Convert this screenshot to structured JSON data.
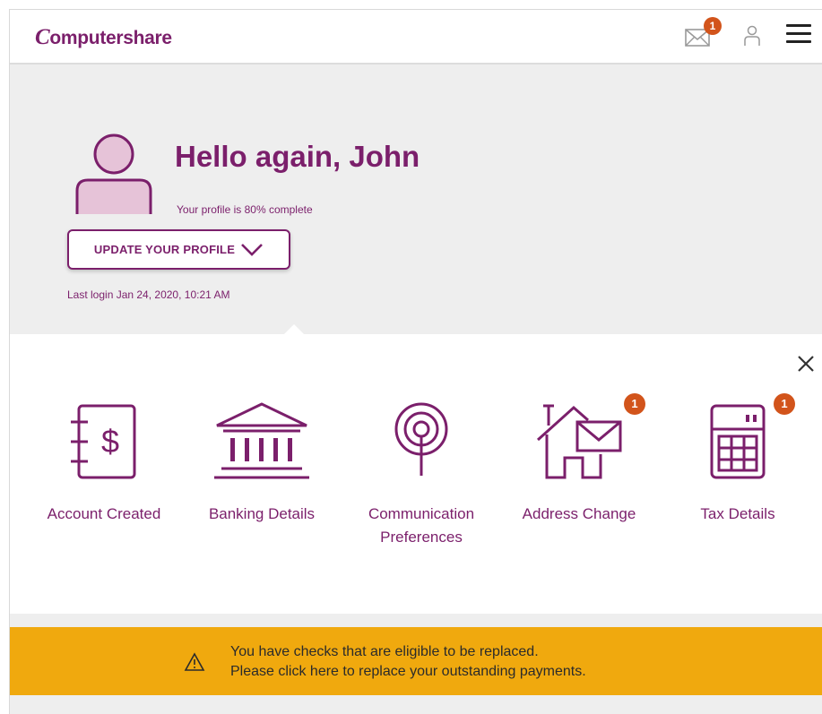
{
  "header": {
    "logo_initial": "C",
    "logo_rest": "omputershare",
    "mail_badge_count": "1"
  },
  "profile": {
    "greeting": "Hello again, John",
    "completion_text": "Your profile is 80% complete",
    "completion_percent": 80,
    "update_button_label": "UPDATE YOUR PROFILE",
    "last_login": "Last login Jan 24, 2020, 10:21 AM"
  },
  "tiles": [
    {
      "label": "Account Created",
      "icon": "account-document-dollar-icon"
    },
    {
      "label": "Banking Details",
      "icon": "bank-icon"
    },
    {
      "label": "Communication Preferences",
      "label_line1": "Communication",
      "label_line2": "Preferences",
      "icon": "broadcast-antenna-icon"
    },
    {
      "label": "Address Change",
      "icon": "house-envelope-icon",
      "badge": "1"
    },
    {
      "label": "Tax Details",
      "icon": "calculator-icon",
      "badge": "1"
    }
  ],
  "alert": {
    "line1": "You have checks that are eligible to be replaced.",
    "line2": "Please click here to replace your outstanding payments.",
    "icon": "warning-triangle-icon"
  },
  "colors": {
    "brand": "#7b1f6b",
    "badge": "#d2541b",
    "alert_bg": "#f0a90e",
    "page_bg": "#eeeeee"
  }
}
